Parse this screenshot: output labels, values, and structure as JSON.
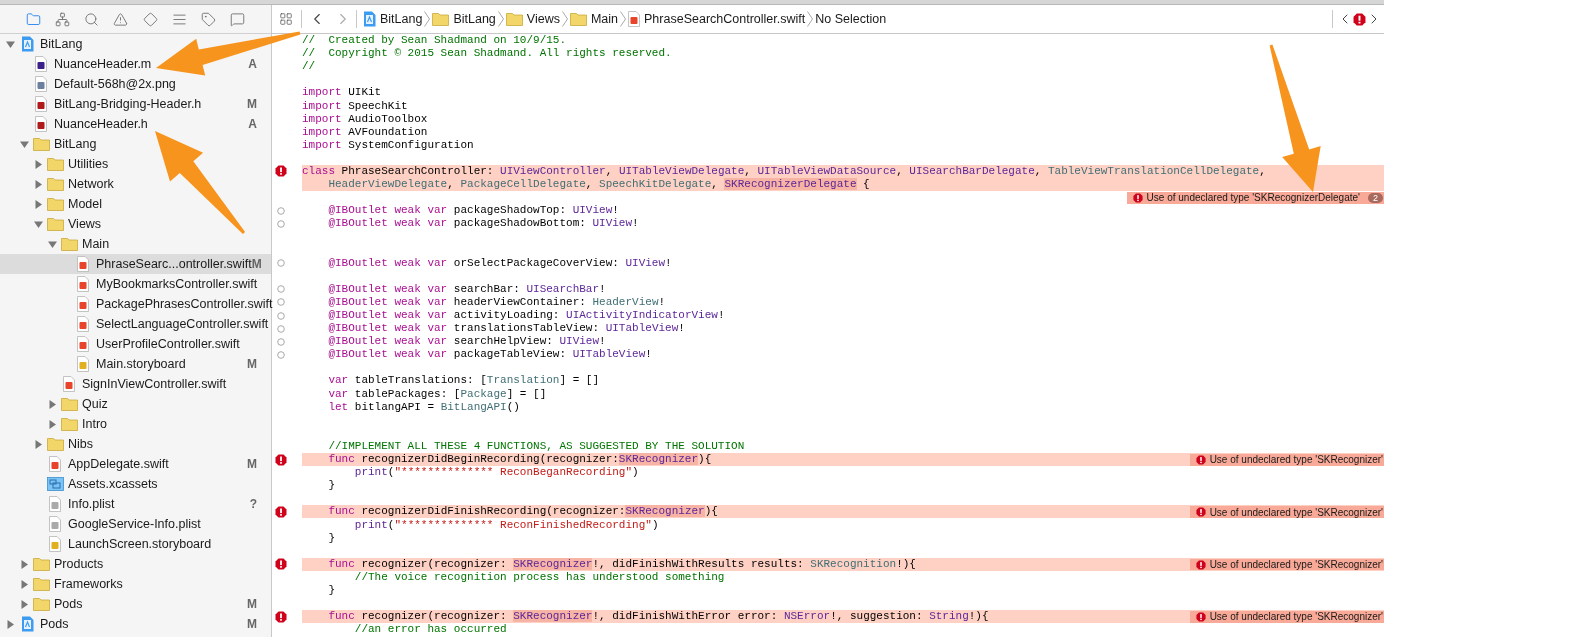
{
  "sidebar": {
    "items": [
      {
        "label": "BitLang",
        "kind": "project",
        "expanded": true,
        "selected": false,
        "children": [
          {
            "label": "NuanceHeader.m",
            "kind": "m",
            "badge": "A",
            "selected": false
          },
          {
            "label": "Default-568h@2x.png",
            "kind": "png",
            "selected": false
          },
          {
            "label": "BitLang-Bridging-Header.h",
            "kind": "h",
            "badge": "M",
            "selected": false
          },
          {
            "label": "NuanceHeader.h",
            "kind": "h",
            "badge": "A",
            "selected": false
          },
          {
            "label": "BitLang",
            "kind": "folder",
            "expanded": true,
            "selected": false,
            "children": [
              {
                "label": "Utilities",
                "kind": "folder",
                "expanded": false,
                "selected": false
              },
              {
                "label": "Network",
                "kind": "folder",
                "expanded": false,
                "selected": false
              },
              {
                "label": "Model",
                "kind": "folder",
                "expanded": false,
                "selected": false
              },
              {
                "label": "Views",
                "kind": "folder",
                "expanded": true,
                "selected": false,
                "children": [
                  {
                    "label": "Main",
                    "kind": "folder",
                    "expanded": true,
                    "selected": false,
                    "children": [
                      {
                        "label": "PhraseSearc...ontroller.swift",
                        "kind": "swift",
                        "badge": "M",
                        "selected": true
                      },
                      {
                        "label": "MyBookmarksController.swift",
                        "kind": "swift",
                        "selected": false
                      },
                      {
                        "label": "PackagePhrasesController.swift",
                        "kind": "swift",
                        "selected": false
                      },
                      {
                        "label": "SelectLanguageController.swift",
                        "kind": "swift",
                        "selected": false
                      },
                      {
                        "label": "UserProfileController.swift",
                        "kind": "swift",
                        "selected": false
                      },
                      {
                        "label": "Main.storyboard",
                        "kind": "storyboard",
                        "badge": "M",
                        "selected": false
                      }
                    ]
                  },
                  {
                    "label": "SignInViewController.swift",
                    "kind": "swift",
                    "selected": false
                  },
                  {
                    "label": "Quiz",
                    "kind": "folder",
                    "expanded": false,
                    "selected": false
                  },
                  {
                    "label": "Intro",
                    "kind": "folder",
                    "expanded": false,
                    "selected": false
                  }
                ]
              },
              {
                "label": "Nibs",
                "kind": "folder",
                "expanded": false,
                "selected": false
              },
              {
                "label": "AppDelegate.swift",
                "kind": "swift",
                "badge": "M",
                "selected": false
              },
              {
                "label": "Assets.xcassets",
                "kind": "xcassets",
                "selected": false
              },
              {
                "label": "Info.plist",
                "kind": "plist",
                "badge": "?",
                "selected": false
              },
              {
                "label": "GoogleService-Info.plist",
                "kind": "plist",
                "selected": false
              },
              {
                "label": "LaunchScreen.storyboard",
                "kind": "storyboard",
                "selected": false
              }
            ]
          },
          {
            "label": "Products",
            "kind": "folder",
            "expanded": false,
            "selected": false
          },
          {
            "label": "Frameworks",
            "kind": "folder",
            "expanded": false,
            "selected": false
          },
          {
            "label": "Pods",
            "kind": "folder",
            "badge": "M",
            "expanded": false,
            "selected": false
          }
        ]
      },
      {
        "label": "Pods",
        "kind": "project",
        "badge": "M",
        "expanded": false,
        "selected": false
      }
    ]
  },
  "jump_bar": {
    "crumbs": [
      {
        "label": "BitLang",
        "kind": "project"
      },
      {
        "label": "BitLang",
        "kind": "folder"
      },
      {
        "label": "Views",
        "kind": "folder"
      },
      {
        "label": "Main",
        "kind": "folder"
      },
      {
        "label": "PhraseSearchController.swift",
        "kind": "swift"
      },
      {
        "label": "No Selection",
        "kind": "none"
      }
    ]
  },
  "editor": {
    "lines": [
      {
        "kind": "code",
        "error": false,
        "tokens": [
          {
            "text": "//  Created by Sean Shadmand on 10/9/15.",
            "kind": "comment"
          }
        ]
      },
      {
        "kind": "code",
        "error": false,
        "tokens": [
          {
            "text": "//  Copyright © 2015 Sean Shadmand. All rights reserved.",
            "kind": "comment"
          }
        ]
      },
      {
        "kind": "code",
        "error": false,
        "tokens": [
          {
            "text": "//",
            "kind": "comment"
          }
        ]
      },
      {
        "kind": "blank",
        "error": false
      },
      {
        "kind": "code",
        "error": false,
        "tokens": [
          {
            "text": "import",
            "kind": "keyword"
          },
          {
            "text": " UIKit",
            "kind": "plain"
          }
        ]
      },
      {
        "kind": "code",
        "error": false,
        "tokens": [
          {
            "text": "import",
            "kind": "keyword"
          },
          {
            "text": " SpeechKit",
            "kind": "plain"
          }
        ]
      },
      {
        "kind": "code",
        "error": false,
        "tokens": [
          {
            "text": "import",
            "kind": "keyword"
          },
          {
            "text": " AudioToolbox",
            "kind": "plain"
          }
        ]
      },
      {
        "kind": "code",
        "error": false,
        "tokens": [
          {
            "text": "import",
            "kind": "keyword"
          },
          {
            "text": " AVFoundation",
            "kind": "plain"
          }
        ]
      },
      {
        "kind": "code",
        "error": false,
        "tokens": [
          {
            "text": "import",
            "kind": "keyword"
          },
          {
            "text": " SystemConfiguration",
            "kind": "plain"
          }
        ]
      },
      {
        "kind": "blank",
        "error": false
      },
      {
        "kind": "issue",
        "error": true,
        "tokens": [
          {
            "text": "class",
            "kind": "keyword"
          },
          {
            "text": " PhraseSearchController: ",
            "kind": "plain"
          },
          {
            "text": "UIViewController",
            "kind": "type"
          },
          {
            "text": ", ",
            "kind": "plain"
          },
          {
            "text": "UITableViewDelegate",
            "kind": "type"
          },
          {
            "text": ", ",
            "kind": "plain"
          },
          {
            "text": "UITableViewDataSource",
            "kind": "type"
          },
          {
            "text": ", ",
            "kind": "plain"
          },
          {
            "text": "UISearchBarDelegate",
            "kind": "type"
          },
          {
            "text": ", ",
            "kind": "plain"
          },
          {
            "text": "TableViewTranslationCellDelegate",
            "kind": "project_type"
          },
          {
            "text": ",",
            "kind": "plain"
          }
        ]
      },
      {
        "kind": "code",
        "error": true,
        "tokens": [
          {
            "text": "    HeaderViewDelegate",
            "kind": "project_type"
          },
          {
            "text": ", ",
            "kind": "plain"
          },
          {
            "text": "PackageCellDelegate",
            "kind": "project_type"
          },
          {
            "text": ", ",
            "kind": "plain"
          },
          {
            "text": "SpeechKitDelegate",
            "kind": "project_type"
          },
          {
            "text": ", ",
            "kind": "plain"
          },
          {
            "text": "SKRecognizerDelegate",
            "kind": "flagged"
          },
          {
            "text": " {",
            "kind": "plain"
          }
        ]
      },
      {
        "kind": "blank",
        "error": false,
        "message": "Use of undeclared type 'SKRecognizerDelegate'",
        "count": "2"
      },
      {
        "kind": "outlet",
        "error": false,
        "tokens": [
          {
            "text": "    @IBOutlet weak var",
            "kind": "keyword"
          },
          {
            "text": " packageShadowTop: ",
            "kind": "plain"
          },
          {
            "text": "UIView",
            "kind": "type"
          },
          {
            "text": "!",
            "kind": "plain"
          }
        ]
      },
      {
        "kind": "outlet",
        "error": false,
        "tokens": [
          {
            "text": "    @IBOutlet weak var",
            "kind": "keyword"
          },
          {
            "text": " packageShadowBottom: ",
            "kind": "plain"
          },
          {
            "text": "UIView",
            "kind": "type"
          },
          {
            "text": "!",
            "kind": "plain"
          }
        ]
      },
      {
        "kind": "blank",
        "error": false
      },
      {
        "kind": "blank",
        "error": false
      },
      {
        "kind": "outlet",
        "error": false,
        "tokens": [
          {
            "text": "    @IBOutlet weak var",
            "kind": "keyword"
          },
          {
            "text": " orSelectPackageCoverView: ",
            "kind": "plain"
          },
          {
            "text": "UIView",
            "kind": "type"
          },
          {
            "text": "!",
            "kind": "plain"
          }
        ]
      },
      {
        "kind": "blank",
        "error": false
      },
      {
        "kind": "outlet",
        "error": false,
        "tokens": [
          {
            "text": "    @IBOutlet weak var",
            "kind": "keyword"
          },
          {
            "text": " searchBar: ",
            "kind": "plain"
          },
          {
            "text": "UISearchBar",
            "kind": "type"
          },
          {
            "text": "!",
            "kind": "plain"
          }
        ]
      },
      {
        "kind": "outlet",
        "error": false,
        "tokens": [
          {
            "text": "    @IBOutlet weak var",
            "kind": "keyword"
          },
          {
            "text": " headerViewContainer: ",
            "kind": "plain"
          },
          {
            "text": "HeaderView",
            "kind": "project_type"
          },
          {
            "text": "!",
            "kind": "plain"
          }
        ]
      },
      {
        "kind": "outlet",
        "error": false,
        "tokens": [
          {
            "text": "    @IBOutlet weak var",
            "kind": "keyword"
          },
          {
            "text": " activityLoading: ",
            "kind": "plain"
          },
          {
            "text": "UIActivityIndicatorView",
            "kind": "type"
          },
          {
            "text": "!",
            "kind": "plain"
          }
        ]
      },
      {
        "kind": "outlet",
        "error": false,
        "tokens": [
          {
            "text": "    @IBOutlet weak var",
            "kind": "keyword"
          },
          {
            "text": " translationsTableView: ",
            "kind": "plain"
          },
          {
            "text": "UITableView",
            "kind": "type"
          },
          {
            "text": "!",
            "kind": "plain"
          }
        ]
      },
      {
        "kind": "outlet",
        "error": false,
        "tokens": [
          {
            "text": "    @IBOutlet weak var",
            "kind": "keyword"
          },
          {
            "text": " searchHelpView: ",
            "kind": "plain"
          },
          {
            "text": "UIView",
            "kind": "type"
          },
          {
            "text": "!",
            "kind": "plain"
          }
        ]
      },
      {
        "kind": "outlet",
        "error": false,
        "tokens": [
          {
            "text": "    @IBOutlet weak var",
            "kind": "keyword"
          },
          {
            "text": " packageTableView: ",
            "kind": "plain"
          },
          {
            "text": "UITableView",
            "kind": "type"
          },
          {
            "text": "!",
            "kind": "plain"
          }
        ]
      },
      {
        "kind": "blank",
        "error": false
      },
      {
        "kind": "code",
        "error": false,
        "tokens": [
          {
            "text": "    var",
            "kind": "keyword"
          },
          {
            "text": " tableTranslations: [",
            "kind": "plain"
          },
          {
            "text": "Translation",
            "kind": "project_type"
          },
          {
            "text": "] = []",
            "kind": "plain"
          }
        ]
      },
      {
        "kind": "code",
        "error": false,
        "tokens": [
          {
            "text": "    var",
            "kind": "keyword"
          },
          {
            "text": " tablePackages: [",
            "kind": "plain"
          },
          {
            "text": "Package",
            "kind": "project_type"
          },
          {
            "text": "] = []",
            "kind": "plain"
          }
        ]
      },
      {
        "kind": "code",
        "error": false,
        "tokens": [
          {
            "text": "    let",
            "kind": "keyword"
          },
          {
            "text": " bitlangAPI = ",
            "kind": "plain"
          },
          {
            "text": "BitLangAPI",
            "kind": "project_type"
          },
          {
            "text": "()",
            "kind": "plain"
          }
        ]
      },
      {
        "kind": "blank",
        "error": false
      },
      {
        "kind": "blank",
        "error": false
      },
      {
        "kind": "code",
        "error": false,
        "tokens": [
          {
            "text": "    //IMPLEMENT ALL THESE 4 FUNCTIONS, AS SUGGESTED BY THE SOLUTION",
            "kind": "comment"
          }
        ]
      },
      {
        "kind": "issue",
        "error": true,
        "message": "Use of undeclared type 'SKRecognizer'",
        "tokens": [
          {
            "text": "    func",
            "kind": "keyword"
          },
          {
            "text": " recognizerDidBeginRecording(recognizer:",
            "kind": "plain"
          },
          {
            "text": "SKRecognizer",
            "kind": "flagged"
          },
          {
            "text": "){",
            "kind": "plain"
          }
        ]
      },
      {
        "kind": "code",
        "error": false,
        "tokens": [
          {
            "text": "        print",
            "kind": "type"
          },
          {
            "text": "(",
            "kind": "plain"
          },
          {
            "text": "\"************** ReconBeganRecording\"",
            "kind": "string"
          },
          {
            "text": ")",
            "kind": "plain"
          }
        ]
      },
      {
        "kind": "code",
        "error": false,
        "tokens": [
          {
            "text": "    }",
            "kind": "plain"
          }
        ]
      },
      {
        "kind": "blank",
        "error": false
      },
      {
        "kind": "issue",
        "error": true,
        "message": "Use of undeclared type 'SKRecognizer'",
        "tokens": [
          {
            "text": "    func",
            "kind": "keyword"
          },
          {
            "text": " recognizerDidFinishRecording(recognizer:",
            "kind": "plain"
          },
          {
            "text": "SKRecognizer",
            "kind": "flagged"
          },
          {
            "text": "){",
            "kind": "plain"
          }
        ]
      },
      {
        "kind": "code",
        "error": false,
        "tokens": [
          {
            "text": "        print",
            "kind": "type"
          },
          {
            "text": "(",
            "kind": "plain"
          },
          {
            "text": "\"************** ReconFinishedRecording\"",
            "kind": "string"
          },
          {
            "text": ")",
            "kind": "plain"
          }
        ]
      },
      {
        "kind": "code",
        "error": false,
        "tokens": [
          {
            "text": "    }",
            "kind": "plain"
          }
        ]
      },
      {
        "kind": "blank",
        "error": false
      },
      {
        "kind": "issue",
        "error": true,
        "message": "Use of undeclared type 'SKRecognizer'",
        "tokens": [
          {
            "text": "    func",
            "kind": "keyword"
          },
          {
            "text": " recognizer(recognizer: ",
            "kind": "plain"
          },
          {
            "text": "SKRecognizer",
            "kind": "flagged"
          },
          {
            "text": "!, didFinishWithResults results: ",
            "kind": "plain"
          },
          {
            "text": "SKRecognition",
            "kind": "project_type"
          },
          {
            "text": "!){",
            "kind": "plain"
          }
        ]
      },
      {
        "kind": "code",
        "error": false,
        "tokens": [
          {
            "text": "        //The voice recognition process has understood something",
            "kind": "comment"
          }
        ]
      },
      {
        "kind": "code",
        "error": false,
        "tokens": [
          {
            "text": "    }",
            "kind": "plain"
          }
        ]
      },
      {
        "kind": "blank",
        "error": false
      },
      {
        "kind": "issue",
        "error": true,
        "message": "Use of undeclared type 'SKRecognizer'",
        "tokens": [
          {
            "text": "    func",
            "kind": "keyword"
          },
          {
            "text": " recognizer(recognizer: ",
            "kind": "plain"
          },
          {
            "text": "SKRecognizer",
            "kind": "flagged"
          },
          {
            "text": "!, didFinishWithError error: ",
            "kind": "plain"
          },
          {
            "text": "NSError",
            "kind": "type"
          },
          {
            "text": "!, suggestion: ",
            "kind": "plain"
          },
          {
            "text": "String",
            "kind": "type"
          },
          {
            "text": "!){",
            "kind": "plain"
          }
        ]
      },
      {
        "kind": "code",
        "error": false,
        "tokens": [
          {
            "text": "        //an error has occurred",
            "kind": "comment"
          }
        ]
      }
    ]
  }
}
